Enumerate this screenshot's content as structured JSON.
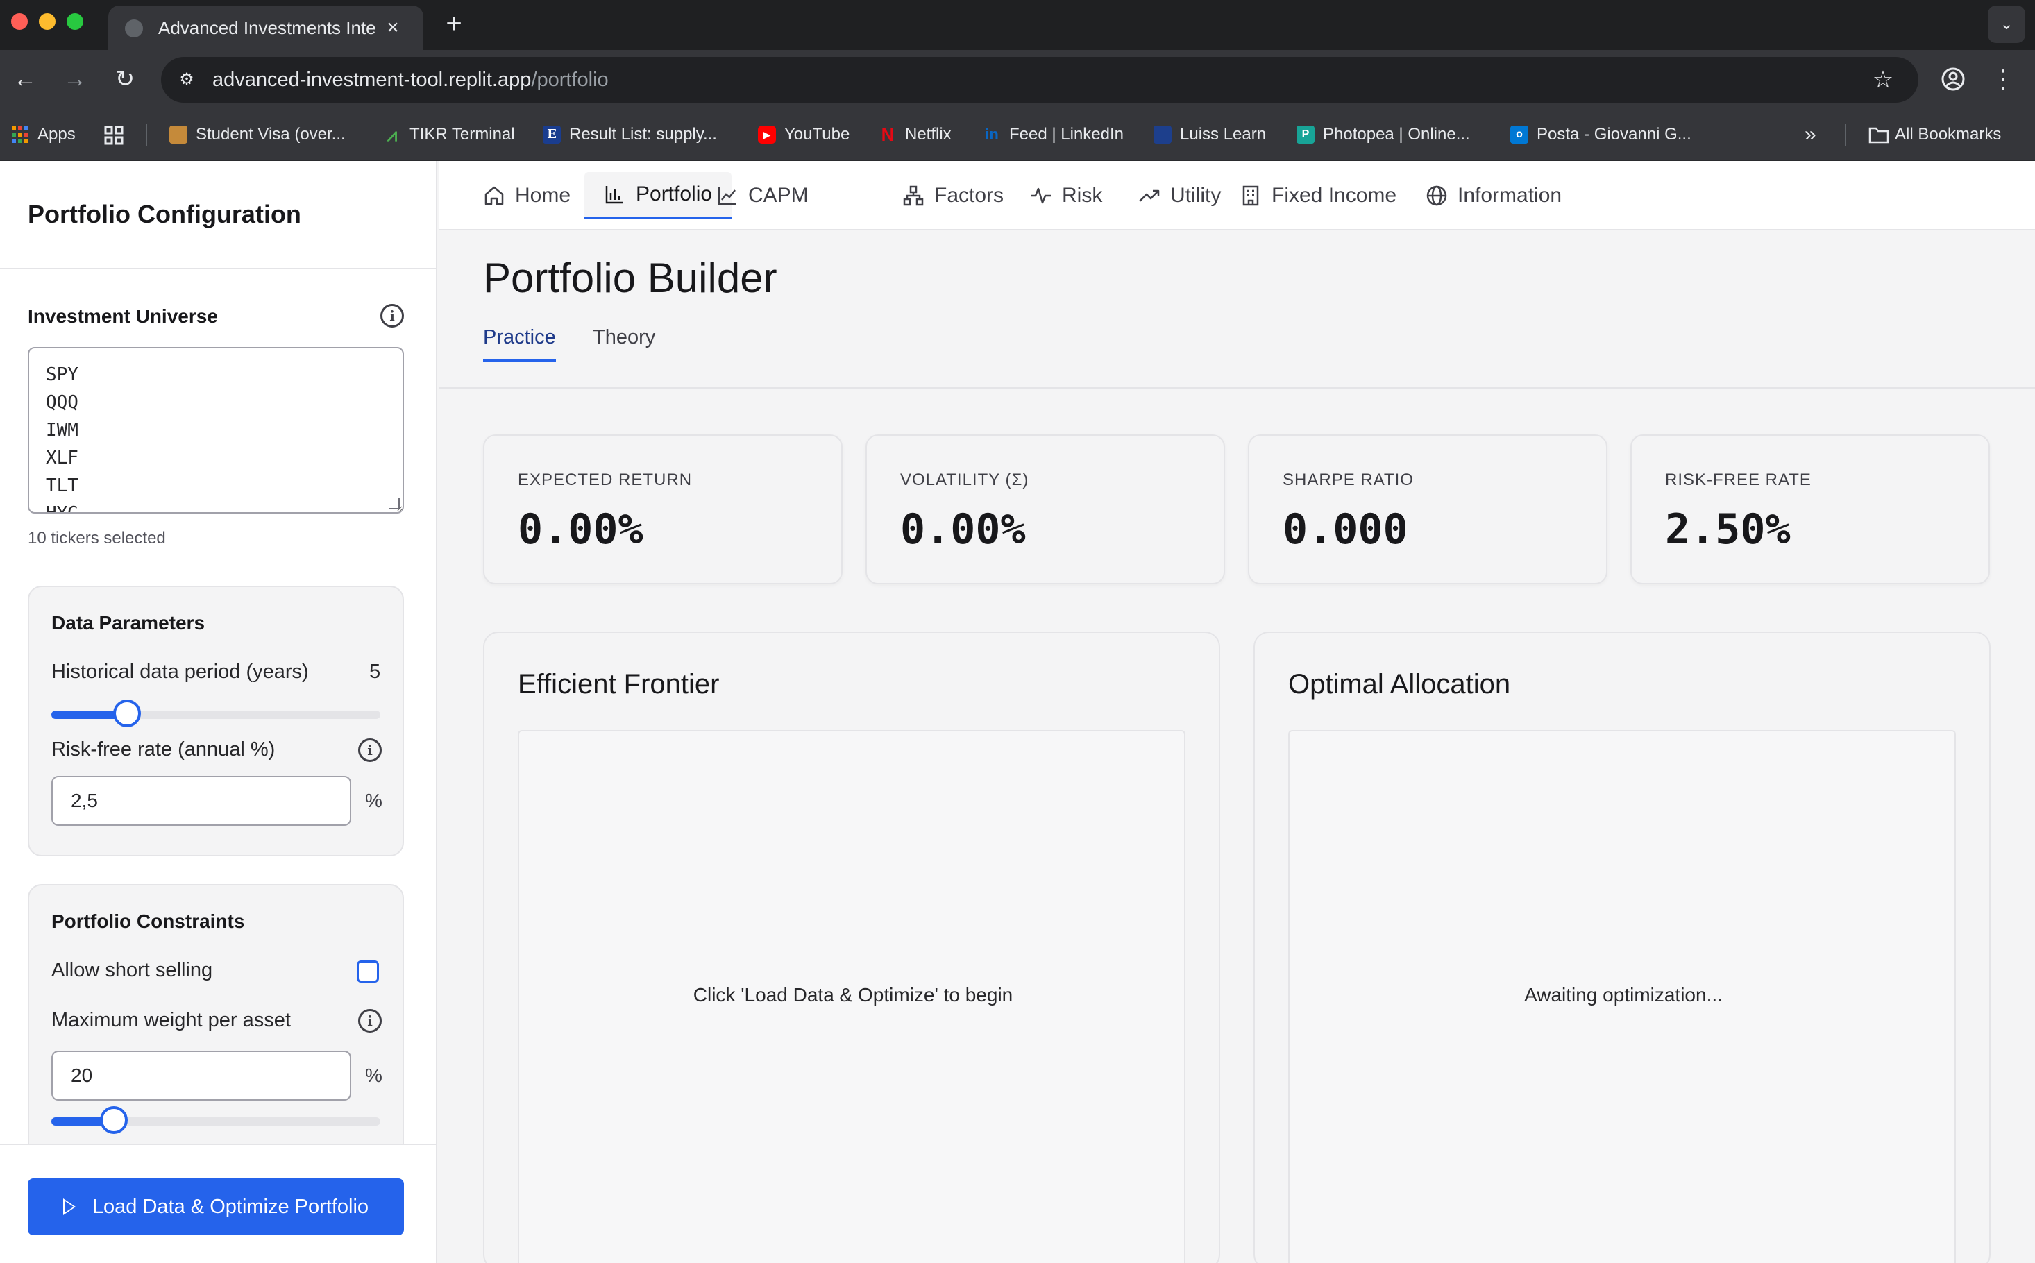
{
  "browser": {
    "tab_title": "Advanced Investments Interac",
    "url_host": "advanced-investment-tool.replit.app",
    "url_path": "/portfolio",
    "bookmarks": [
      {
        "label": "Apps",
        "icon": "apps-grid-icon",
        "color": "#f29900"
      },
      {
        "label": "",
        "icon": "grid-icon",
        "color": "#e8eaed"
      },
      {
        "label": "Student Visa (over...",
        "icon": "crest-icon",
        "color": "#c58a3a"
      },
      {
        "label": "TIKR Terminal",
        "icon": "tikr-icon",
        "color": "#4caf50"
      },
      {
        "label": "Result List: supply...",
        "icon": "ebsco-icon",
        "color": "#1a3d8f"
      },
      {
        "label": "YouTube",
        "icon": "youtube-icon",
        "color": "#ff0000"
      },
      {
        "label": "Netflix",
        "icon": "netflix-icon",
        "color": "#e50914"
      },
      {
        "label": "Feed | LinkedIn",
        "icon": "linkedin-icon",
        "color": "#0a66c2"
      },
      {
        "label": "Luiss Learn",
        "icon": "luiss-icon",
        "color": "#1d3f8c"
      },
      {
        "label": "Photopea | Online...",
        "icon": "photopea-icon",
        "color": "#18a497"
      },
      {
        "label": "Posta - Giovanni G...",
        "icon": "outlook-icon",
        "color": "#0078d4"
      }
    ],
    "all_bookmarks": "All Bookmarks"
  },
  "sidebar": {
    "title": "Portfolio Configuration",
    "universe_label": "Investment Universe",
    "tickers": [
      "SPY",
      "QQQ",
      "IWM",
      "XLF",
      "TLT",
      "HYG"
    ],
    "tickers_selected": "10 tickers selected",
    "data_params": {
      "title": "Data Parameters",
      "period_label": "Historical data period (years)",
      "period_value": "5",
      "period_slider_fraction": 0.23,
      "rf_label": "Risk-free rate (annual %)",
      "rf_value": "2,5",
      "rf_unit": "%"
    },
    "constraints": {
      "title": "Portfolio Constraints",
      "short_label": "Allow short selling",
      "short_checked": false,
      "maxw_label": "Maximum weight per asset",
      "maxw_value": "20",
      "maxw_unit": "%",
      "maxw_slider_fraction": 0.19
    },
    "optimize_button": "Load Data & Optimize Portfolio"
  },
  "nav": {
    "items": [
      {
        "label": "Home",
        "icon": "home-icon"
      },
      {
        "label": "Portfolio",
        "icon": "bar-chart-icon",
        "active": true
      },
      {
        "label": "CAPM",
        "icon": "line-chart-icon"
      },
      {
        "label": "Factors",
        "icon": "network-icon"
      },
      {
        "label": "Risk",
        "icon": "activity-icon"
      },
      {
        "label": "Utility",
        "icon": "trending-up-icon"
      },
      {
        "label": "Fixed Income",
        "icon": "building-icon"
      },
      {
        "label": "Information",
        "icon": "globe-icon"
      }
    ]
  },
  "page": {
    "title": "Portfolio Builder",
    "subtabs": [
      "Practice",
      "Theory"
    ],
    "stats": [
      {
        "key": "EXPECTED RETURN",
        "value": "0.00%"
      },
      {
        "key": "VOLATILITY (Σ)",
        "value": "0.00%"
      },
      {
        "key": "SHARPE RATIO",
        "value": "0.000"
      },
      {
        "key": "RISK-FREE RATE",
        "value": "2.50%"
      }
    ],
    "frontier": {
      "title": "Efficient Frontier",
      "placeholder": "Click 'Load Data & Optimize' to begin"
    },
    "allocation": {
      "title": "Optimal Allocation",
      "placeholder": "Awaiting optimization..."
    }
  },
  "colors": {
    "accent": "#2563eb",
    "chrome_dark": "#1f2022",
    "chrome": "#35363a"
  }
}
